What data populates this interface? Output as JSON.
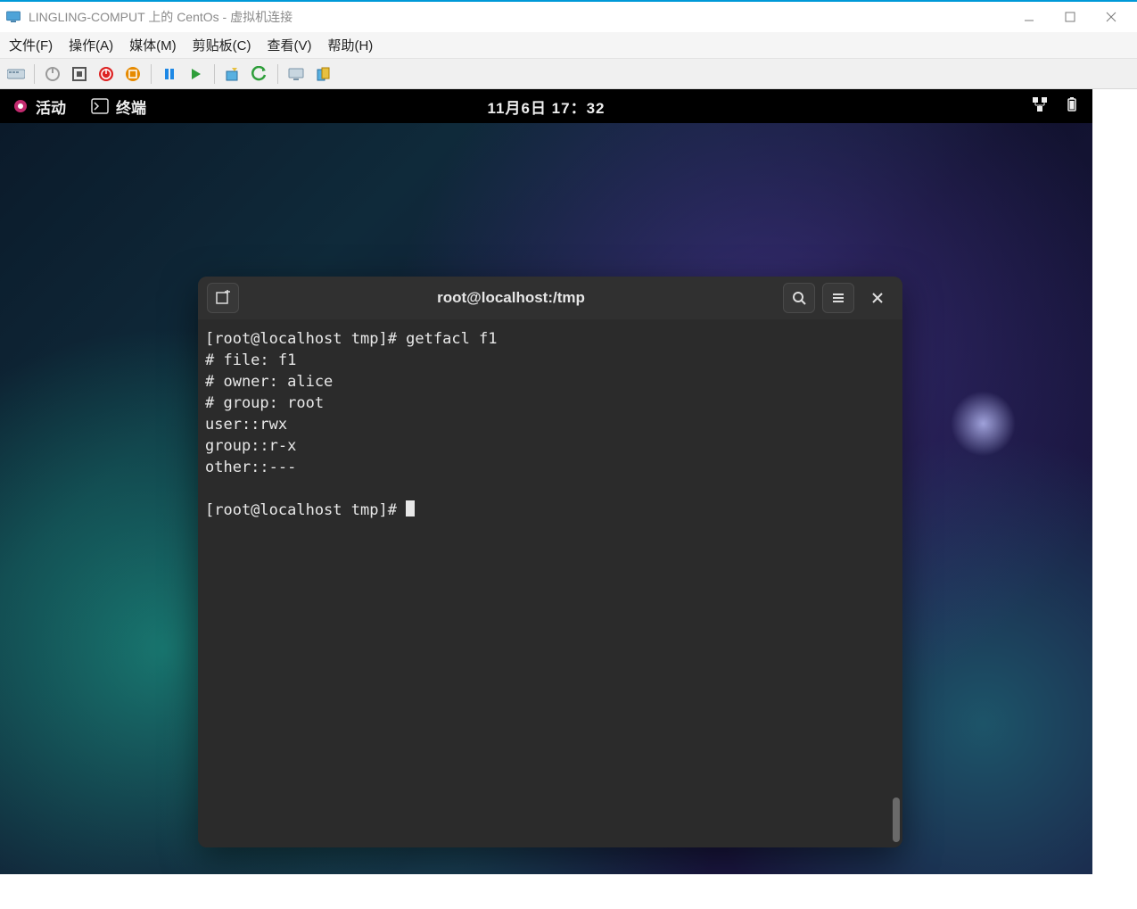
{
  "hypervisor": {
    "title": "LINGLING-COMPUT 上的 CentOs - 虚拟机连接",
    "menu": [
      "文件(F)",
      "操作(A)",
      "媒体(M)",
      "剪贴板(C)",
      "查看(V)",
      "帮助(H)"
    ]
  },
  "gnome": {
    "activities": "活动",
    "app": "终端",
    "clock": "11月6日 17：32"
  },
  "terminal": {
    "title": "root@localhost:/tmp",
    "lines": [
      "[root@localhost tmp]# getfacl f1",
      "# file: f1",
      "# owner: alice",
      "# group: root",
      "user::rwx",
      "group::r-x",
      "other::---",
      "",
      "[root@localhost tmp]# "
    ]
  }
}
